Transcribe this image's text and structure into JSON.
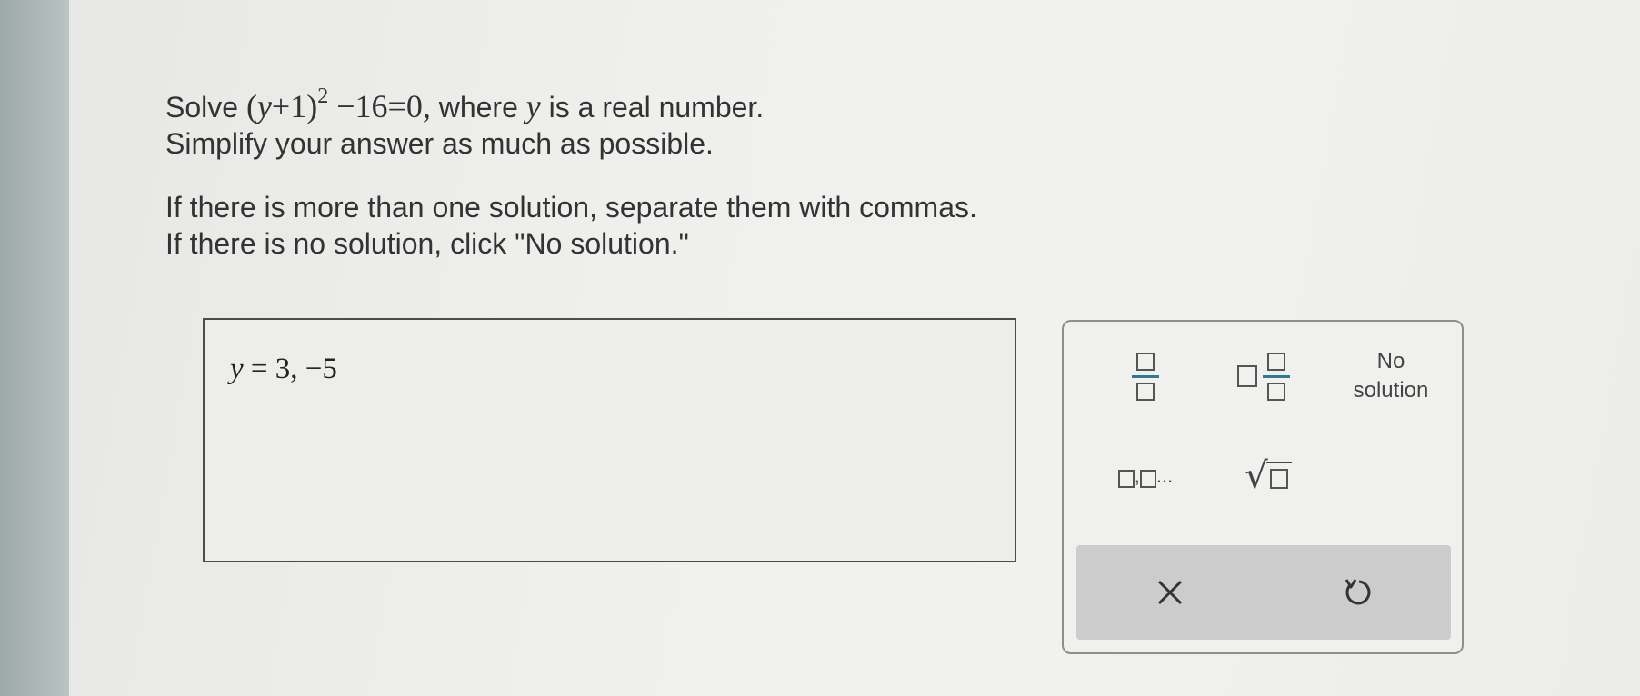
{
  "question": {
    "solve_label": "Solve",
    "eq_open": "(",
    "eq_var": "y",
    "eq_plus_one": "+1)",
    "eq_exponent": "2",
    "eq_rest": "−16=0,",
    "where_label": "where",
    "where_var": "y",
    "line1_end": "is a real number.",
    "line2": "Simplify your answer as much as possible.",
    "line3": "If there is more than one solution, separate them with commas.",
    "line4": "If there is no solution, click \"No solution.\""
  },
  "answer": {
    "var": "y",
    "rest": " = 3, −5"
  },
  "keypad": {
    "no_solution_line1": "No",
    "no_solution_line2": "solution",
    "list_suffix": "..."
  },
  "actions": {
    "clear_icon": "x-icon",
    "undo_icon": "undo-icon"
  },
  "colors": {
    "fraction_bar": "#2c7a95",
    "action_bar_bg": "#cccccc"
  }
}
